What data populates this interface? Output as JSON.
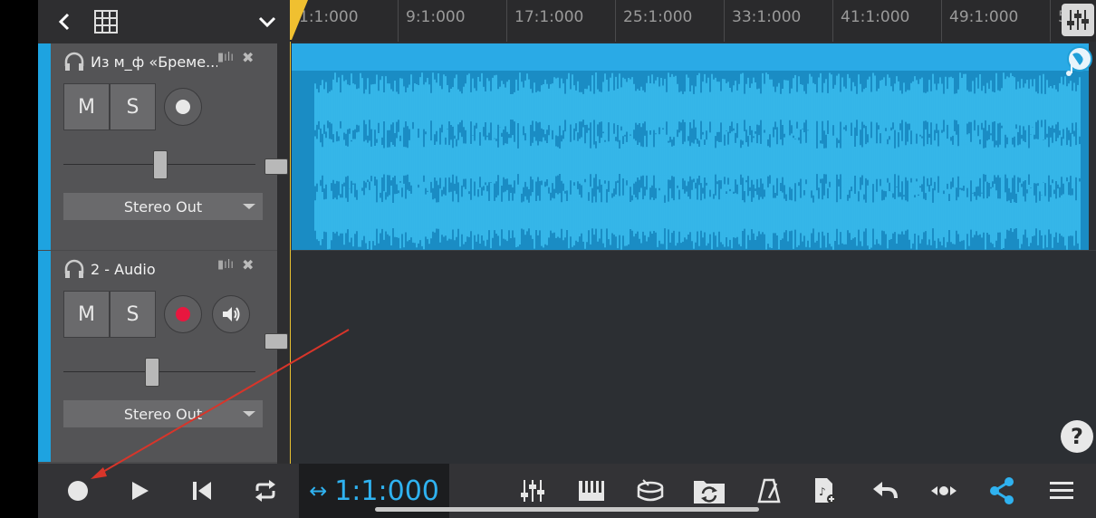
{
  "topbar": {
    "back_icon": "chevron-left-icon",
    "grid_icon": "grid-icon",
    "collapse_icon": "chevron-down-icon"
  },
  "ruler": {
    "ticks": [
      "1:1:000",
      "9:1:000",
      "17:1:000",
      "25:1:000",
      "33:1:000",
      "41:1:000",
      "49:1:000",
      "5"
    ],
    "mixer_icon": "mixer-sliders-icon"
  },
  "tracks": [
    {
      "name": "Из м_ф «Бреме...",
      "mute_label": "M",
      "solo_label": "S",
      "output": "Stereo Out",
      "record_color": "#e8e8e8",
      "volume_level": 0.5
    },
    {
      "name": "2 - Audio",
      "mute_label": "M",
      "solo_label": "S",
      "output": "Stereo Out",
      "record_color": "#e8173f",
      "volume_level": 0.45
    }
  ],
  "clip": {
    "color": "#1f9fd8"
  },
  "help_label": "?",
  "transport": {
    "time": "1:1:000",
    "time_prefix": "↔",
    "accent": "#2fb2f0"
  },
  "toolbar_icons": [
    "record-icon",
    "play-icon",
    "skip-start-icon",
    "loop-icon",
    "mixer-icon",
    "piano-icon",
    "drum-icon",
    "sync-folder-icon",
    "metronome-icon",
    "add-file-icon",
    "undo-icon",
    "move-icon",
    "share-icon",
    "menu-icon"
  ]
}
